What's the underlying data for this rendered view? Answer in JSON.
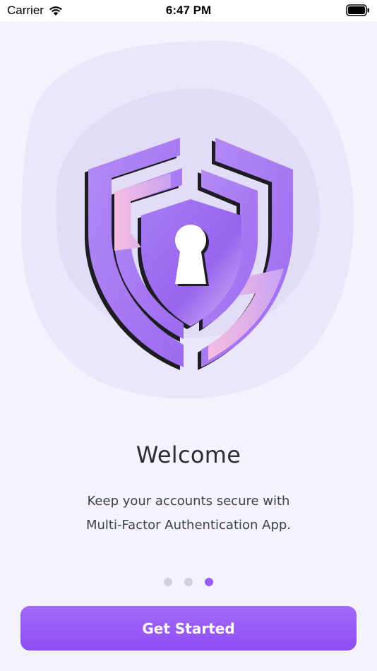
{
  "status_bar": {
    "carrier": "Carrier",
    "time": "6:47 PM",
    "icons": [
      "wifi-icon",
      "battery-icon"
    ]
  },
  "illustration": {
    "icon": "shield-keyhole-icon",
    "colors": {
      "purple": "#a478f3",
      "pink": "#f4b6dc",
      "dark": "#1d1c22",
      "blob": "#ebe7fa"
    }
  },
  "onboarding": {
    "title": "Welcome",
    "subtitle_line1": "Keep your accounts secure with",
    "subtitle_line2": "Multi-Factor Authentication App.",
    "page_indicator": {
      "count": 3,
      "active_index": 2
    },
    "cta_label": "Get Started"
  },
  "colors": {
    "accent": "#9a5cf2",
    "background": "#f3f3fd",
    "text_primary": "#2b2c36"
  }
}
